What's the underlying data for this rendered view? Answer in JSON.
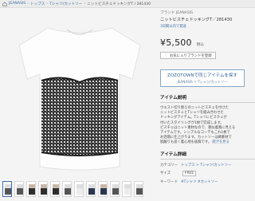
{
  "breadcrumb": {
    "items": [
      "JEANASIS",
      "トップス",
      "Tシャツ/カットソー"
    ],
    "current": "ニットビスチェドッキングT / 281430"
  },
  "product": {
    "brand": "ブランド JEANASIS",
    "name": "ニットビスチェドッキングT／281430",
    "shipping_note": "3日間以内で発送",
    "price": "¥5,500",
    "price_tax": "税込",
    "favorite_label": "お気に入りブランドを登録"
  },
  "zozo": {
    "main": "ZOZOTOWNで同じアイテムを探す",
    "sub": "JEANASIS > Tシャツ/カットソー"
  },
  "item_description": {
    "title": "アイテム説明",
    "lines": [
      "ウエスト切り替えのニットビスチェを付けた",
      "ニットビスチェとTシャツを組み合わせた",
      "ドッキングアイテム。Tシャツにビスチェが",
      "付いたスタイリングが1枚で完成します。",
      "ビスチェはニット素材なので、重ね着風に見える",
      "アイテムです。シンプルなコーデもこれ1枚で",
      "お洒落に仕上がります。カットソーは綿素材で",
      "肌触りも良く着心地も抜群です。"
    ],
    "more_link": "続きを見る"
  },
  "item_detail": {
    "title": "アイテム詳細",
    "rows": [
      {
        "key": "カテゴリー",
        "value": "トップス > Tシャツ/カットソー"
      },
      {
        "key": "サイズ",
        "value": "FREE"
      },
      {
        "key": "キーワード",
        "value": "#Tシャツ #カットソー"
      }
    ]
  },
  "thumbnails": [
    "product-front",
    "knit-detail",
    "model-front",
    "model-side",
    "model-back",
    "knit-closeup",
    "shirt-plain",
    "navy-front",
    "navy-model",
    "label-detail",
    "fabric-detail",
    "size-chart"
  ],
  "colors": {
    "link": "#3b6ea5",
    "zozo_border": "#8aa6c4"
  }
}
